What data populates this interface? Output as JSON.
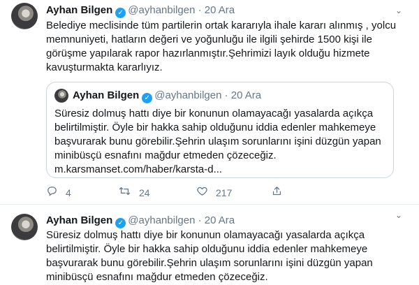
{
  "tweet1": {
    "name": "Ayhan Bilgen",
    "handle": "@ayhanbilgen",
    "separator": "·",
    "date": "20 Ara",
    "text": "Belediye meclisinde tüm partilerin ortak kararıyla ihale kararı alınmış , yolcu memnuniyeti, hatların değeri ve yoğunluğu ile ilgili şehirde 1500 kişi ile görüşme yapılarak rapor hazırlanmıştır.Şehrimizi layık olduğu hizmete kavuşturmakta kararlıyız.",
    "quote": {
      "name": "Ayhan Bilgen",
      "handle": "@ayhanbilgen",
      "separator": "·",
      "date": "20 Ara",
      "text": "Süresiz dolmuş hattı diye bir konunun olamayacağı yasalarda açıkça belirtilmiştir. Öyle bir hakka sahip olduğunu iddia edenler mahkemeye başvurarak bunu görebilir.Şehrin ulaşım sorunlarını işini düzgün yapan minibüsçü esnafını mağdur etmeden çözeceğiz.",
      "url": "m.karsmanset.com/haber/karsta-d..."
    },
    "actions": {
      "reply_count": "4",
      "retweet_count": "24",
      "like_count": "217"
    }
  },
  "tweet2": {
    "name": "Ayhan Bilgen",
    "handle": "@ayhanbilgen",
    "separator": "·",
    "date": "20 Ara",
    "text": "Süresiz dolmuş hattı diye bir konunun olamayacağı yasalarda açıkça belirtilmiştir. Öyle bir hakka sahip olduğunu iddia edenler mahkemeye başvurarak bunu görebilir.Şehrin ulaşım sorunlarını işini düzgün yapan minibüsçü esnafını mağdur etmeden çözeceğiz."
  },
  "icons": {
    "verified": "verified-badge-icon",
    "caret": "chevron-down-icon",
    "reply": "reply-icon",
    "retweet": "retweet-icon",
    "like": "heart-icon",
    "share": "share-icon"
  },
  "colors": {
    "accent": "#1da1f2",
    "muted": "#657786",
    "border": "#ccd6dd"
  }
}
